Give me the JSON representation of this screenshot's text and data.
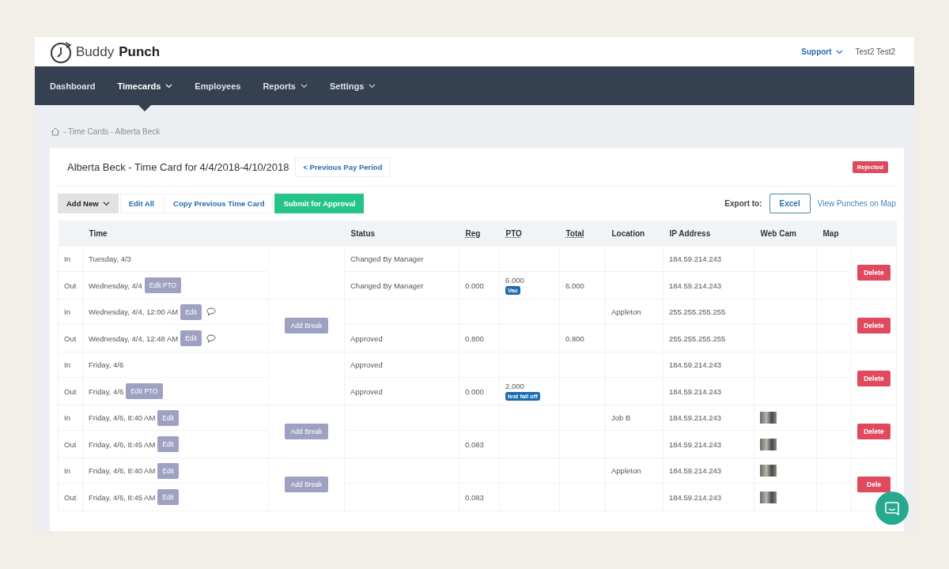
{
  "header": {
    "logo_light": "Buddy",
    "logo_bold": "Punch",
    "support": "Support",
    "user": "Test2 Test2"
  },
  "nav": [
    {
      "label": "Dashboard",
      "dropdown": false,
      "selected": false
    },
    {
      "label": "Timecards",
      "dropdown": true,
      "selected": true
    },
    {
      "label": "Employees",
      "dropdown": false,
      "selected": false
    },
    {
      "label": "Reports",
      "dropdown": true,
      "selected": false
    },
    {
      "label": "Settings",
      "dropdown": true,
      "selected": false
    }
  ],
  "breadcrumb": "- Time Cards - Alberta Beck",
  "timecard": {
    "title": "Alberta Beck - Time Card for 4/4/2018-4/10/2018",
    "previous": "< Previous Pay Period",
    "status_badge": "Rejected"
  },
  "toolbar": {
    "buttons": [
      {
        "label": "Add New",
        "kind": "dropdown"
      },
      {
        "label": "Edit All",
        "kind": "link"
      },
      {
        "label": "Copy Previous Time Card",
        "kind": "link"
      },
      {
        "label": "Submit for Approval",
        "kind": "primary"
      }
    ],
    "export_label": "Export to:",
    "export_button": "Excel",
    "map_link": "View Punches on Map"
  },
  "table": {
    "columns": [
      {
        "label": "Time",
        "underlined": false
      },
      {
        "label": "Status",
        "underlined": false
      },
      {
        "label": "Reg",
        "underlined": true
      },
      {
        "label": "PTO",
        "underlined": true
      },
      {
        "label": "Total",
        "underlined": true
      },
      {
        "label": "Location",
        "underlined": false
      },
      {
        "label": "IP Address",
        "underlined": false
      },
      {
        "label": "Web Cam",
        "underlined": false
      },
      {
        "label": "Map",
        "underlined": false
      }
    ],
    "groups": [
      {
        "delete": "Delete",
        "punches": [
          {
            "type": "In",
            "time": "Tuesday, 4/3",
            "comment": false,
            "status": "Changed By Manager",
            "ip": "184.59.214.243",
            "webcam": false
          },
          {
            "type": "Out",
            "time": "Wednesday, 4/4",
            "edit": "Edit PTO",
            "comment": false,
            "status": "Changed By Manager",
            "reg": "0.000",
            "pto": "6.000",
            "pto_tag": "Vac",
            "total": "6.000",
            "ip": "184.59.214.243",
            "webcam": false
          }
        ]
      },
      {
        "break_button": "Add Break",
        "delete": "Delete",
        "punches": [
          {
            "type": "In",
            "time": "Wednesday, 4/4, 12:00 AM",
            "edit": "Edit",
            "comment": true,
            "location": "Appleton",
            "ip": "255.255.255.255",
            "webcam": false
          },
          {
            "type": "Out",
            "time": "Wednesday, 4/4, 12:48 AM",
            "edit": "Edit",
            "comment": true,
            "status": "Approved",
            "reg": "0.800",
            "total": "0.800",
            "ip": "255.255.255.255",
            "webcam": false
          }
        ]
      },
      {
        "delete": "Delete",
        "punches": [
          {
            "type": "In",
            "time": "Friday, 4/6",
            "comment": false,
            "status": "Approved",
            "ip": "184.59.214.243",
            "webcam": false
          },
          {
            "type": "Out",
            "time": "Friday, 4/6",
            "edit": "Edit PTO",
            "comment": false,
            "status": "Approved",
            "reg": "0.000",
            "pto": "2.000",
            "pto_tag": "test fall off",
            "ip": "184.59.214.243",
            "webcam": false
          }
        ]
      },
      {
        "break_button": "Add Break",
        "delete": "Delete",
        "punches": [
          {
            "type": "In",
            "time": "Friday, 4/6, 8:40 AM",
            "edit": "Edit",
            "comment": false,
            "location": "Job B",
            "ip": "184.59.214.243",
            "webcam": true
          },
          {
            "type": "Out",
            "time": "Friday, 4/6, 8:45 AM",
            "edit": "Edit",
            "comment": false,
            "reg": "0.083",
            "ip": "184.59.214.243",
            "webcam": true
          }
        ]
      },
      {
        "break_button": "Add Break",
        "delete": "Dele",
        "punches": [
          {
            "type": "In",
            "time": "Friday, 4/6, 8:40 AM",
            "edit": "Edit",
            "comment": false,
            "location": "Appleton",
            "ip": "184.59.214.243",
            "webcam": true
          },
          {
            "type": "Out",
            "time": "Friday, 4/6, 8:45 AM",
            "edit": "Edit",
            "comment": false,
            "reg": "0.083",
            "ip": "184.59.214.243",
            "webcam": true
          }
        ]
      }
    ]
  }
}
